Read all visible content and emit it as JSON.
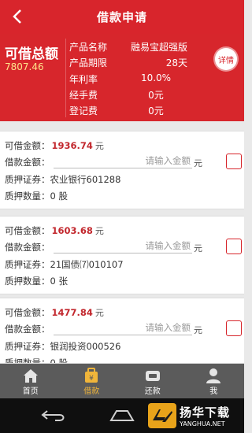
{
  "header": {
    "title": "借款申请",
    "back_icon": "chevron-left-icon"
  },
  "summary": {
    "total_label": "可借总额",
    "total_value": "7807.46",
    "rows": [
      {
        "key": "产品名称",
        "value": "融易宝超强版"
      },
      {
        "key": "产品期限",
        "value": "28天"
      },
      {
        "key": "年利率",
        "value": "10.0%"
      },
      {
        "key": "经手费",
        "value": "0元"
      },
      {
        "key": "登记费",
        "value": "0元"
      }
    ],
    "detail_label": "详情"
  },
  "labels": {
    "available": "可借金额：",
    "borrow": "借款金额：",
    "pledge": "质押证券：",
    "quantity": "质押数量：",
    "unit_yuan": "元",
    "placeholder": "请输入金额"
  },
  "items": [
    {
      "available": "1936.74",
      "security": "农业银行601288",
      "quantity": "0 股"
    },
    {
      "available": "1603.68",
      "security": "21国债⑺010107",
      "quantity": "0 张"
    },
    {
      "available": "1477.84",
      "security": "银润投资000526",
      "quantity": "0 股"
    }
  ],
  "tabbar": {
    "tabs": [
      {
        "label": "首页",
        "icon": "home-icon"
      },
      {
        "label": "借款",
        "icon": "loan-icon",
        "active": true
      },
      {
        "label": "还款",
        "icon": "repay-icon"
      },
      {
        "label": "我",
        "icon": "user-icon"
      }
    ]
  },
  "watermark": {
    "cn": "扬华下载",
    "en": "YANGHUA.NET"
  },
  "colors": {
    "primary": "#d7262c",
    "active_tab": "#f0b53a"
  }
}
